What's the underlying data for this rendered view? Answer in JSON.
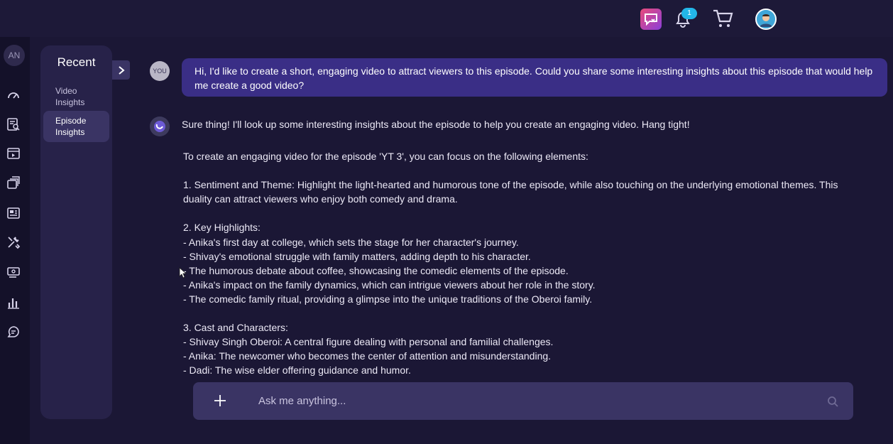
{
  "topbar": {
    "notification_count": "1",
    "icons": [
      "app-chat-icon",
      "bell-icon",
      "cart-icon",
      "profile-avatar-icon"
    ]
  },
  "iconrail": {
    "avatar_initials": "AN",
    "icons": [
      "dashboard-icon",
      "report-search-icon",
      "video-icon",
      "library-icon",
      "news-icon",
      "tools-icon",
      "monetize-icon",
      "analytics-icon",
      "chat-icon"
    ]
  },
  "recent": {
    "title": "Recent",
    "items": [
      {
        "label_line1": "Video",
        "label_line2": "Insights",
        "active": false
      },
      {
        "label_line1": "Episode",
        "label_line2": "Insights",
        "active": true
      }
    ]
  },
  "chat": {
    "user_badge": "YOU",
    "user_message": "Hi, I'd like to create a short, engaging video to attract viewers to this episode. Could you share some interesting insights about this episode that would help me create a good video?",
    "bot_intro": "Sure thing! I'll look up some interesting insights about the episode to help you create an engaging video. Hang tight!",
    "answer_lines": [
      "To create an engaging video for the episode 'YT 3', you can focus on the following elements:",
      "",
      "1. Sentiment and Theme: Highlight the light-hearted and humorous tone of the episode, while also touching on the underlying emotional themes. This duality can attract viewers who enjoy both comedy and drama.",
      "",
      "2. Key Highlights:",
      "- Anika's first day at college, which sets the stage for her character's journey.",
      "- Shivay's emotional struggle with family matters, adding depth to his character.",
      "- The humorous debate about coffee, showcasing the comedic elements of the episode.",
      "- Anika's impact on the family dynamics, which can intrigue viewers about her role in the story.",
      "- The comedic family ritual, providing a glimpse into the unique traditions of the Oberoi family.",
      "",
      "3. Cast and Characters:",
      "- Shivay Singh Oberoi: A central figure dealing with personal and familial challenges.",
      "- Anika: The newcomer who becomes the center of attention and misunderstanding.",
      "- Dadi: The wise elder offering guidance and humor."
    ]
  },
  "input": {
    "placeholder": "Ask me anything...",
    "value": ""
  },
  "colors": {
    "background": "#1b1735",
    "panel": "#272249",
    "user_bubble": "#3a2e86",
    "input_bar": "#3a3464",
    "badge": "#23b6e8"
  }
}
